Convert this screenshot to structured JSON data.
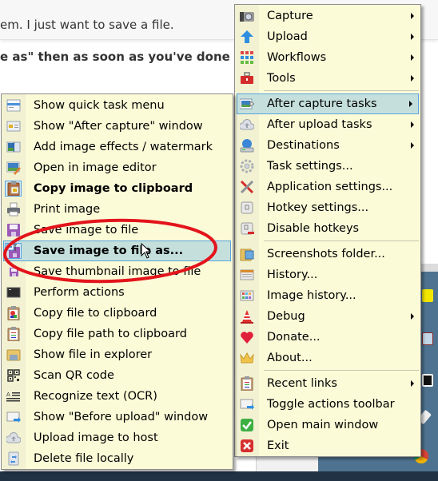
{
  "background": {
    "text_line_1": "em. I just want to save a file.",
    "text_line_2": "e as\" then as soon as you've done the"
  },
  "main_menu": {
    "items": [
      {
        "label": "Capture",
        "icon": "camera-icon",
        "submenu": true
      },
      {
        "label": "Upload",
        "icon": "upload-arrow-icon",
        "submenu": true
      },
      {
        "label": "Workflows",
        "icon": "workflows-grid-icon",
        "submenu": true
      },
      {
        "label": "Tools",
        "icon": "toolbox-icon",
        "submenu": true
      },
      {
        "label": "After capture tasks",
        "icon": "after-capture-icon",
        "submenu": true,
        "highlighted": true
      },
      {
        "label": "After upload tasks",
        "icon": "cloud-upload-icon",
        "submenu": true
      },
      {
        "label": "Destinations",
        "icon": "destinations-icon",
        "submenu": true
      },
      {
        "label": "Task settings...",
        "icon": "gear-icon",
        "submenu": false
      },
      {
        "label": "Application settings...",
        "icon": "wrench-screwdriver-icon",
        "submenu": false
      },
      {
        "label": "Hotkey settings...",
        "icon": "keyboard-key-icon",
        "submenu": false
      },
      {
        "label": "Disable hotkeys",
        "icon": "keyboard-key-disabled-icon",
        "submenu": false
      },
      {
        "label": "Screenshots folder...",
        "icon": "folder-icon",
        "submenu": false
      },
      {
        "label": "History...",
        "icon": "history-icon",
        "submenu": false
      },
      {
        "label": "Image history...",
        "icon": "image-history-icon",
        "submenu": false
      },
      {
        "label": "Debug",
        "icon": "traffic-cone-icon",
        "submenu": true
      },
      {
        "label": "Donate...",
        "icon": "heart-icon",
        "submenu": false
      },
      {
        "label": "About...",
        "icon": "crown-icon",
        "submenu": false
      },
      {
        "label": "Recent links",
        "icon": "clipboard-list-icon",
        "submenu": true
      },
      {
        "label": "Toggle actions toolbar",
        "icon": "toolbar-arrow-icon",
        "submenu": false
      },
      {
        "label": "Open main window",
        "icon": "check-green-icon",
        "submenu": false
      },
      {
        "label": "Exit",
        "icon": "close-red-icon",
        "submenu": false
      }
    ]
  },
  "after_capture_menu": {
    "items": [
      {
        "label": "Show quick task menu",
        "icon": "quick-task-menu-icon"
      },
      {
        "label": "Show \"After capture\" window",
        "icon": "after-capture-window-icon"
      },
      {
        "label": "Add image effects / watermark",
        "icon": "image-effects-icon"
      },
      {
        "label": "Open in image editor",
        "icon": "image-editor-icon"
      },
      {
        "label": "Copy image to clipboard",
        "icon": "clipboard-image-icon",
        "bold": true,
        "checked": true
      },
      {
        "label": "Print image",
        "icon": "printer-icon"
      },
      {
        "label": "Save image to file",
        "icon": "floppy-disk-icon"
      },
      {
        "label": "Save image to file as...",
        "icon": "floppy-save-as-icon",
        "bold": true,
        "checked": true,
        "highlighted": true
      },
      {
        "label": "Save thumbnail image to file",
        "icon": "floppy-thumbnail-icon"
      },
      {
        "label": "Perform actions",
        "icon": "terminal-icon"
      },
      {
        "label": "Copy file to clipboard",
        "icon": "clipboard-file-icon"
      },
      {
        "label": "Copy file path to clipboard",
        "icon": "clipboard-path-icon"
      },
      {
        "label": "Show file in explorer",
        "icon": "explorer-folder-icon"
      },
      {
        "label": "Scan QR code",
        "icon": "qr-code-icon"
      },
      {
        "label": "Recognize text (OCR)",
        "icon": "ocr-text-icon"
      },
      {
        "label": "Show \"Before upload\" window",
        "icon": "before-upload-window-icon"
      },
      {
        "label": "Upload image to host",
        "icon": "cloud-upload-icon"
      },
      {
        "label": "Delete file locally",
        "icon": "delete-file-icon"
      }
    ]
  },
  "colors": {
    "menu_background": "#fbfbd8",
    "highlight_background": "#c5e0dc",
    "highlight_border": "#58a3e0",
    "annotation_red": "#e3141b"
  }
}
